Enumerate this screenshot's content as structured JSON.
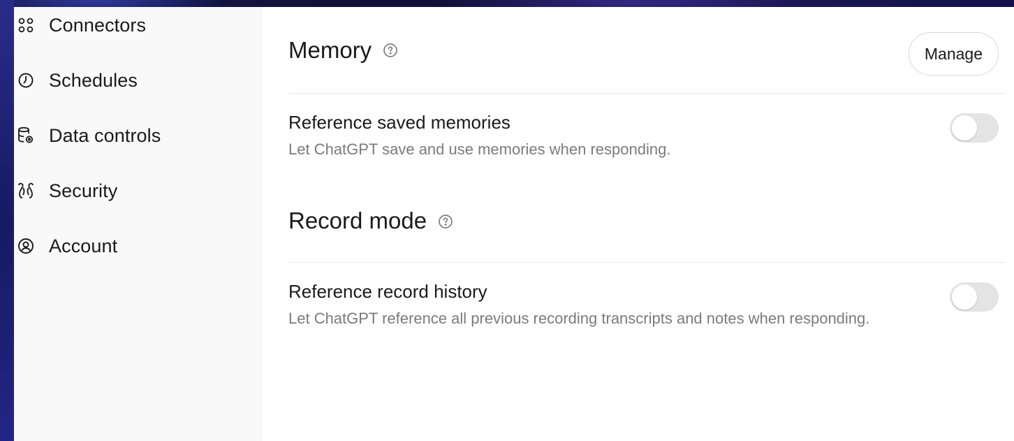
{
  "sidebar": {
    "items": [
      {
        "label": "Connectors",
        "icon": "connectors-icon"
      },
      {
        "label": "Schedules",
        "icon": "clock-icon"
      },
      {
        "label": "Data controls",
        "icon": "database-gear-icon"
      },
      {
        "label": "Security",
        "icon": "shield-icon"
      },
      {
        "label": "Account",
        "icon": "user-circle-icon"
      }
    ]
  },
  "memory": {
    "title": "Memory",
    "manage_label": "Manage",
    "setting": {
      "title": "Reference saved memories",
      "description": "Let ChatGPT save and use memories when responding.",
      "enabled": false
    }
  },
  "record_mode": {
    "title": "Record mode",
    "setting": {
      "title": "Reference record history",
      "description": "Let ChatGPT reference all previous recording transcripts and notes when responding.",
      "enabled": false
    }
  },
  "colors": {
    "toggle_off": "#e4e4e4",
    "text_primary": "#1a1a1a",
    "text_secondary": "#7b7b7b"
  }
}
